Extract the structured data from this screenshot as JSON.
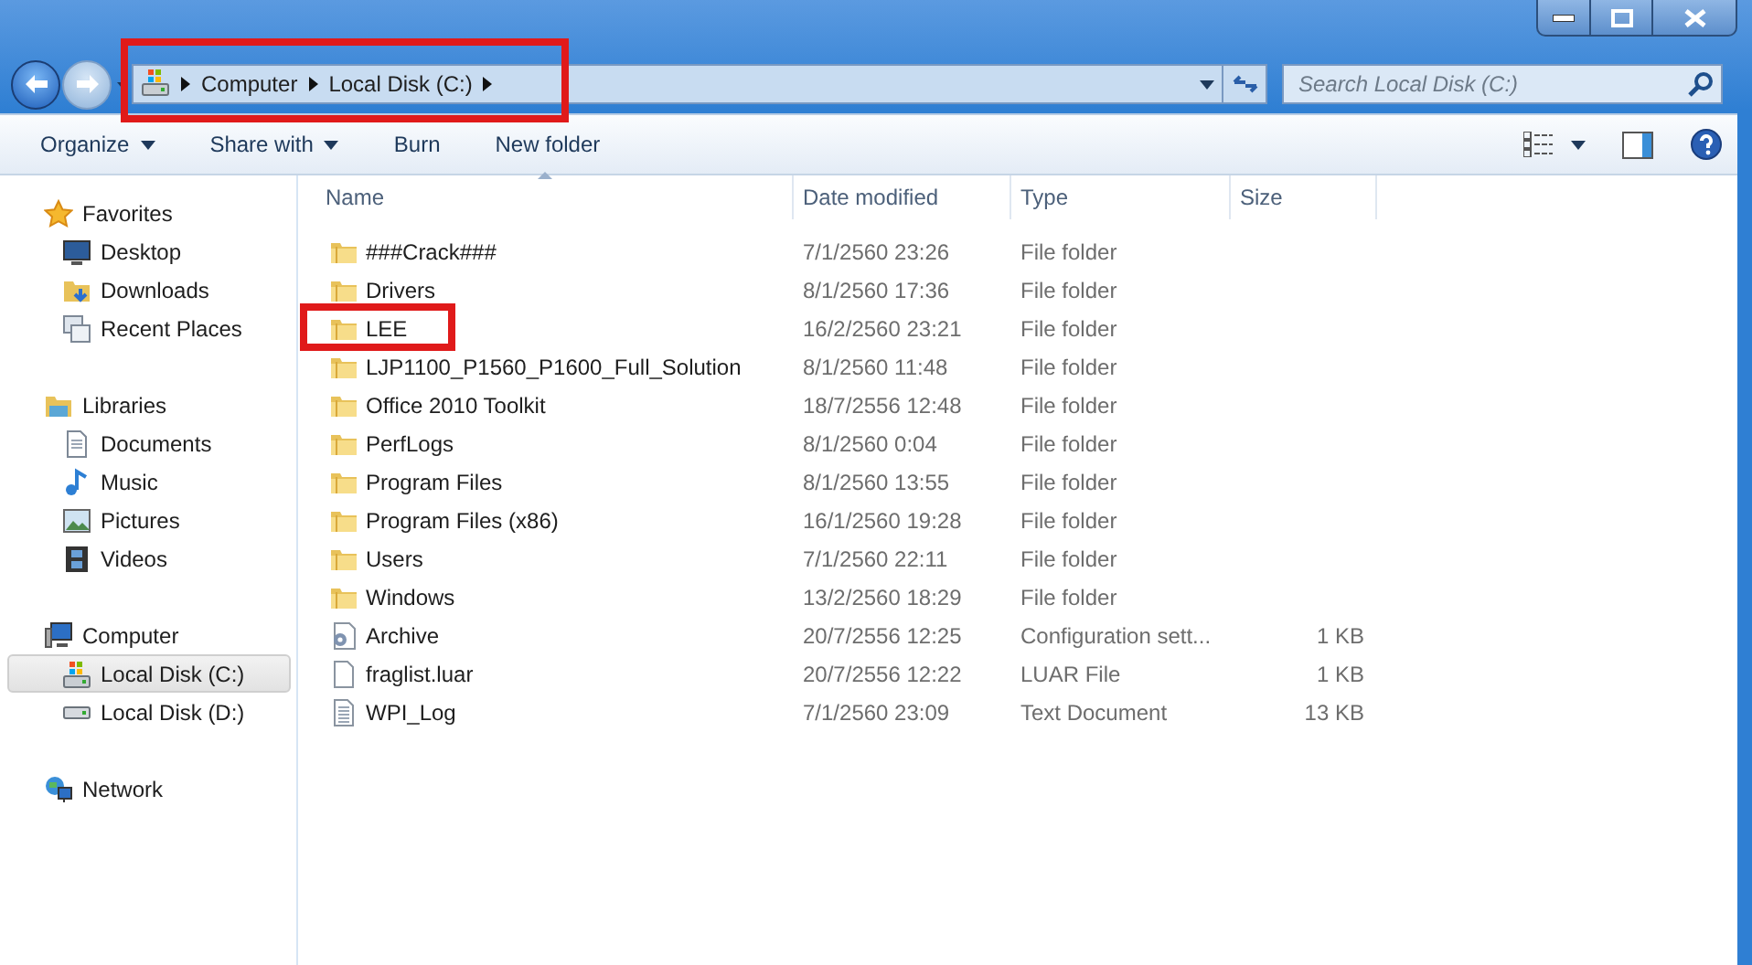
{
  "address_bar": {
    "breadcrumbs": [
      "Computer",
      "Local Disk (C:)"
    ],
    "highlighted": true
  },
  "search": {
    "placeholder": "Search Local Disk (C:)"
  },
  "toolbar": {
    "items": [
      {
        "label": "Organize",
        "has_menu": true
      },
      {
        "label": "Share with",
        "has_menu": true
      },
      {
        "label": "Burn",
        "has_menu": false
      },
      {
        "label": "New folder",
        "has_menu": false
      }
    ]
  },
  "sidebar": {
    "groups": [
      {
        "label": "Favorites",
        "kind": "star",
        "children": [
          {
            "label": "Desktop",
            "kind": "desktop",
            "selected": false
          },
          {
            "label": "Downloads",
            "kind": "downloads",
            "selected": false
          },
          {
            "label": "Recent Places",
            "kind": "recent",
            "selected": false
          }
        ]
      },
      {
        "label": "Libraries",
        "kind": "libraries",
        "children": [
          {
            "label": "Documents",
            "kind": "documents",
            "selected": false
          },
          {
            "label": "Music",
            "kind": "music",
            "selected": false
          },
          {
            "label": "Pictures",
            "kind": "pictures",
            "selected": false
          },
          {
            "label": "Videos",
            "kind": "videos",
            "selected": false
          }
        ]
      },
      {
        "label": "Computer",
        "kind": "computer",
        "children": [
          {
            "label": "Local Disk (C:)",
            "kind": "system-drive",
            "selected": true
          },
          {
            "label": "Local Disk (D:)",
            "kind": "drive",
            "selected": false
          }
        ]
      },
      {
        "label": "Network",
        "kind": "network"
      }
    ]
  },
  "file_list": {
    "columns": [
      {
        "label": "Name",
        "sorted": true
      },
      {
        "label": "Date modified",
        "sorted": false
      },
      {
        "label": "Type",
        "sorted": false
      },
      {
        "label": "Size",
        "sorted": false
      }
    ],
    "rows": [
      {
        "name": "###Crack###",
        "date_modified": "7/1/2560 23:26",
        "type": "File folder",
        "kind": "folder",
        "highlighted": false
      },
      {
        "name": "Drivers",
        "date_modified": "8/1/2560 17:36",
        "type": "File folder",
        "kind": "folder",
        "highlighted": false
      },
      {
        "name": "LEE",
        "date_modified": "16/2/2560 23:21",
        "type": "File folder",
        "kind": "folder",
        "highlighted": true
      },
      {
        "name": "LJP1100_P1560_P1600_Full_Solution",
        "date_modified": "8/1/2560 11:48",
        "type": "File folder",
        "kind": "folder",
        "highlighted": false
      },
      {
        "name": "Office 2010 Toolkit",
        "date_modified": "18/7/2556 12:48",
        "type": "File folder",
        "kind": "folder",
        "highlighted": false
      },
      {
        "name": "PerfLogs",
        "date_modified": "8/1/2560 0:04",
        "type": "File folder",
        "kind": "folder",
        "highlighted": false
      },
      {
        "name": "Program Files",
        "date_modified": "8/1/2560 13:55",
        "type": "File folder",
        "kind": "folder",
        "highlighted": false
      },
      {
        "name": "Program Files (x86)",
        "date_modified": "16/1/2560 19:28",
        "type": "File folder",
        "kind": "folder",
        "highlighted": false
      },
      {
        "name": "Users",
        "date_modified": "7/1/2560 22:11",
        "type": "File folder",
        "kind": "folder",
        "highlighted": false
      },
      {
        "name": "Windows",
        "date_modified": "13/2/2560 18:29",
        "type": "File folder",
        "kind": "folder",
        "highlighted": false
      },
      {
        "name": "Archive",
        "date_modified": "20/7/2556 12:25",
        "type": "Configuration sett...",
        "size": "1 KB",
        "kind": "settings",
        "highlighted": false
      },
      {
        "name": "fraglist.luar",
        "date_modified": "20/7/2556 12:22",
        "type": "LUAR File",
        "size": "1 KB",
        "kind": "file",
        "highlighted": false
      },
      {
        "name": "WPI_Log",
        "date_modified": "7/1/2560 23:09",
        "type": "Text Document",
        "size": "13 KB",
        "kind": "text",
        "highlighted": false
      }
    ]
  }
}
